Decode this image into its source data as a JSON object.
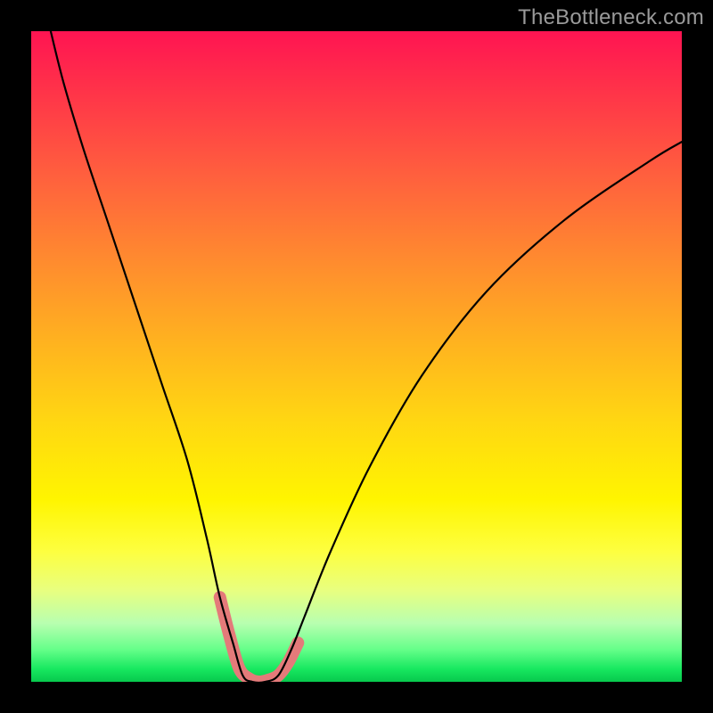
{
  "watermark": "TheBottleneck.com",
  "chart_data": {
    "type": "line",
    "title": "",
    "xlabel": "",
    "ylabel": "",
    "xlim": [
      0,
      100
    ],
    "ylim": [
      0,
      100
    ],
    "background_gradient": {
      "top": "#ff1452",
      "mid_upper": "#ff8a2f",
      "mid": "#fff500",
      "bottom": "#18e860",
      "note": "red (high bottleneck) at top → green (no bottleneck) at bottom"
    },
    "series": [
      {
        "name": "bottleneck-curve",
        "color": "#000000",
        "x": [
          3,
          5,
          8,
          12,
          16,
          20,
          24,
          27,
          29,
          31,
          32.5,
          34,
          36,
          38,
          40,
          42,
          46,
          52,
          60,
          70,
          82,
          95,
          100
        ],
        "y": [
          100,
          92,
          82,
          70,
          58,
          46,
          34,
          22,
          13,
          6,
          1,
          0,
          0,
          1,
          5,
          10,
          20,
          33,
          47,
          60,
          71,
          80,
          83
        ],
        "note": "y is plotted downward from top; 0 = bottom (green), 100 = top (red). Minimum around x≈34–38."
      },
      {
        "name": "highlight-segment",
        "color": "#e47a7a",
        "stroke_width": 14,
        "x": [
          29,
          30.5,
          32,
          33.5,
          35,
          36.5,
          38,
          39.5,
          41
        ],
        "y": [
          13,
          7,
          2,
          0.5,
          0,
          0.3,
          1,
          3,
          6
        ],
        "note": "thick salmon marker band along the bottom of the V"
      }
    ]
  }
}
